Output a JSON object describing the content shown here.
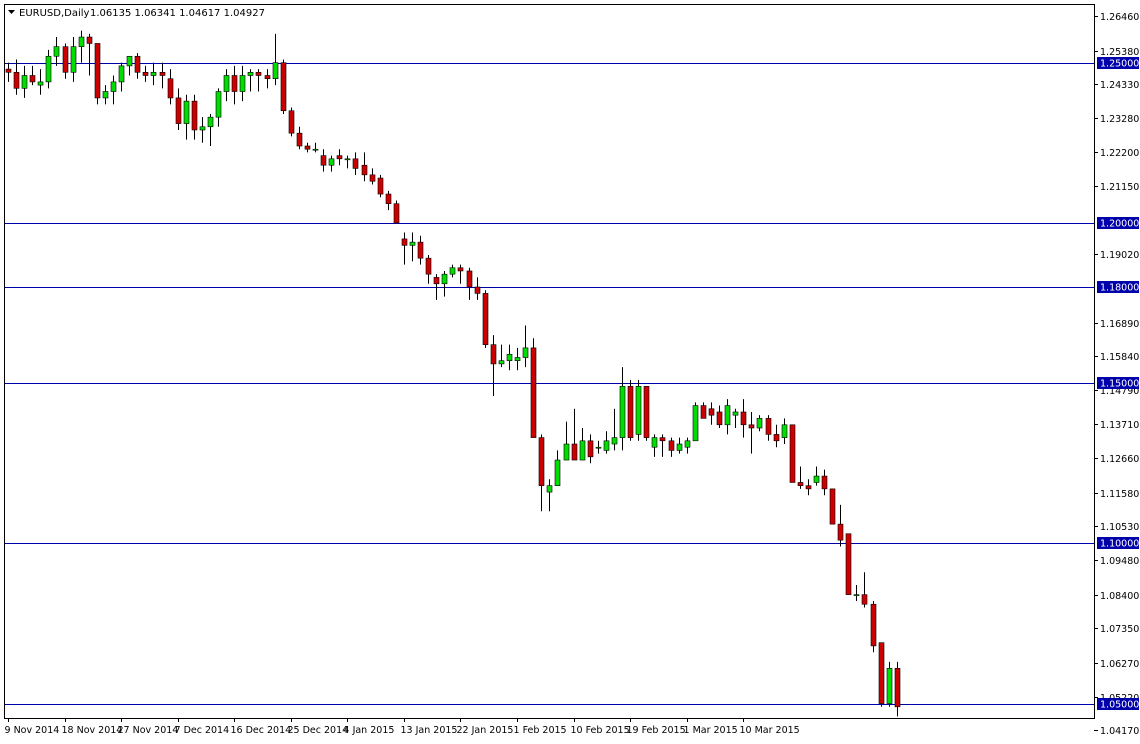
{
  "header": {
    "arrow_icon": "triangle-down-icon",
    "symbol": "EURUSD,Daily",
    "ohlc": "1.06135 1.06341 1.04617 1.04927"
  },
  "colors": {
    "background": "#ffffff",
    "frame": "#000000",
    "up_candle": "#00dd00",
    "down_candle": "#cc0000",
    "wick": "#000000",
    "level_line": "#0000aa",
    "label_bg": "#0000aa",
    "label_text": "#ffffff"
  },
  "chart_data": {
    "type": "candlestick",
    "title": "EURUSD,Daily",
    "ylim": [
      1.0455,
      1.268
    ],
    "y_ticks": [
      1.2646,
      1.2538,
      1.2433,
      1.2328,
      1.222,
      1.2115,
      1.1902,
      1.1689,
      1.1584,
      1.1479,
      1.1371,
      1.1266,
      1.1158,
      1.1053,
      1.0948,
      1.084,
      1.0735,
      1.0627,
      1.0522,
      1.0417
    ],
    "x_labels": [
      {
        "index": 0,
        "label": "9 Nov 2014"
      },
      {
        "index": 7,
        "label": "18 Nov 2014"
      },
      {
        "index": 14,
        "label": "27 Nov 2014"
      },
      {
        "index": 21,
        "label": "7 Dec 2014"
      },
      {
        "index": 28,
        "label": "16 Dec 2014"
      },
      {
        "index": 35,
        "label": "25 Dec 2014"
      },
      {
        "index": 42,
        "label": "4 Jan 2015"
      },
      {
        "index": 49,
        "label": "13 Jan 2015"
      },
      {
        "index": 56,
        "label": "22 Jan 2015"
      },
      {
        "index": 63,
        "label": "1 Feb 2015"
      },
      {
        "index": 70,
        "label": "10 Feb 2015"
      },
      {
        "index": 77,
        "label": "19 Feb 2015"
      },
      {
        "index": 84,
        "label": "1 Mar 2015"
      },
      {
        "index": 91,
        "label": "10 Mar 2015"
      }
    ],
    "levels": [
      {
        "value": 1.25,
        "label": "1.25000"
      },
      {
        "value": 1.2,
        "label": "1.20000"
      },
      {
        "value": 1.18,
        "label": "1.18000"
      },
      {
        "value": 1.15,
        "label": "1.15000"
      },
      {
        "value": 1.1,
        "label": "1.10000"
      },
      {
        "value": 1.05,
        "label": "1.05000"
      }
    ],
    "candles": [
      [
        1.248,
        1.25,
        1.244,
        1.247
      ],
      [
        1.247,
        1.251,
        1.24,
        1.242
      ],
      [
        1.242,
        1.249,
        1.239,
        1.246
      ],
      [
        1.246,
        1.249,
        1.243,
        1.244
      ],
      [
        1.243,
        1.248,
        1.24,
        1.244
      ],
      [
        1.244,
        1.254,
        1.242,
        1.252
      ],
      [
        1.252,
        1.258,
        1.249,
        1.255
      ],
      [
        1.255,
        1.256,
        1.245,
        1.247
      ],
      [
        1.247,
        1.258,
        1.244,
        1.255
      ],
      [
        1.255,
        1.26,
        1.25,
        1.258
      ],
      [
        1.258,
        1.259,
        1.246,
        1.256
      ],
      [
        1.256,
        1.256,
        1.237,
        1.239
      ],
      [
        1.239,
        1.243,
        1.237,
        1.241
      ],
      [
        1.241,
        1.246,
        1.237,
        1.244
      ],
      [
        1.244,
        1.25,
        1.241,
        1.249
      ],
      [
        1.249,
        1.252,
        1.246,
        1.252
      ],
      [
        1.252,
        1.253,
        1.245,
        1.247
      ],
      [
        1.247,
        1.249,
        1.244,
        1.246
      ],
      [
        1.246,
        1.25,
        1.243,
        1.247
      ],
      [
        1.247,
        1.25,
        1.242,
        1.246
      ],
      [
        1.245,
        1.248,
        1.237,
        1.239
      ],
      [
        1.239,
        1.242,
        1.229,
        1.231
      ],
      [
        1.231,
        1.24,
        1.226,
        1.238
      ],
      [
        1.238,
        1.24,
        1.226,
        1.229
      ],
      [
        1.229,
        1.233,
        1.225,
        1.23
      ],
      [
        1.23,
        1.234,
        1.224,
        1.233
      ],
      [
        1.233,
        1.242,
        1.23,
        1.241
      ],
      [
        1.241,
        1.248,
        1.238,
        1.246
      ],
      [
        1.246,
        1.249,
        1.237,
        1.241
      ],
      [
        1.241,
        1.249,
        1.238,
        1.246
      ],
      [
        1.246,
        1.248,
        1.241,
        1.247
      ],
      [
        1.247,
        1.248,
        1.241,
        1.246
      ],
      [
        1.246,
        1.248,
        1.242,
        1.245
      ],
      [
        1.245,
        1.259,
        1.243,
        1.25
      ],
      [
        1.25,
        1.251,
        1.234,
        1.235
      ],
      [
        1.235,
        1.236,
        1.227,
        1.228
      ],
      [
        1.228,
        1.23,
        1.223,
        1.224
      ],
      [
        1.224,
        1.225,
        1.222,
        1.223
      ],
      [
        1.223,
        1.225,
        1.222,
        1.223
      ],
      [
        1.221,
        1.223,
        1.216,
        1.218
      ],
      [
        1.218,
        1.221,
        1.216,
        1.22
      ],
      [
        1.221,
        1.223,
        1.218,
        1.22
      ],
      [
        1.22,
        1.221,
        1.217,
        1.22
      ],
      [
        1.22,
        1.222,
        1.215,
        1.217
      ],
      [
        1.218,
        1.222,
        1.213,
        1.215
      ],
      [
        1.215,
        1.217,
        1.212,
        1.213
      ],
      [
        1.214,
        1.215,
        1.208,
        1.209
      ],
      [
        1.209,
        1.21,
        1.204,
        1.206
      ],
      [
        1.206,
        1.207,
        1.2,
        1.2
      ],
      [
        1.195,
        1.197,
        1.187,
        1.193
      ],
      [
        1.193,
        1.197,
        1.188,
        1.194
      ],
      [
        1.194,
        1.196,
        1.187,
        1.189
      ],
      [
        1.189,
        1.19,
        1.181,
        1.184
      ],
      [
        1.183,
        1.184,
        1.176,
        1.181
      ],
      [
        1.181,
        1.185,
        1.177,
        1.184
      ],
      [
        1.184,
        1.187,
        1.183,
        1.186
      ],
      [
        1.186,
        1.187,
        1.181,
        1.185
      ],
      [
        1.185,
        1.186,
        1.176,
        1.18
      ],
      [
        1.18,
        1.183,
        1.176,
        1.178
      ],
      [
        1.178,
        1.179,
        1.161,
        1.162
      ],
      [
        1.162,
        1.165,
        1.146,
        1.156
      ],
      [
        1.156,
        1.162,
        1.155,
        1.157
      ],
      [
        1.157,
        1.162,
        1.154,
        1.159
      ],
      [
        1.157,
        1.161,
        1.154,
        1.158
      ],
      [
        1.158,
        1.168,
        1.155,
        1.161
      ],
      [
        1.161,
        1.164,
        1.133,
        1.133
      ],
      [
        1.133,
        1.134,
        1.11,
        1.118
      ],
      [
        1.116,
        1.12,
        1.11,
        1.118
      ],
      [
        1.118,
        1.129,
        1.118,
        1.126
      ],
      [
        1.126,
        1.138,
        1.126,
        1.131
      ],
      [
        1.131,
        1.142,
        1.126,
        1.126
      ],
      [
        1.126,
        1.136,
        1.126,
        1.132
      ],
      [
        1.132,
        1.134,
        1.125,
        1.127
      ],
      [
        1.13,
        1.132,
        1.128,
        1.13
      ],
      [
        1.129,
        1.135,
        1.128,
        1.132
      ],
      [
        1.131,
        1.142,
        1.129,
        1.133
      ],
      [
        1.133,
        1.155,
        1.129,
        1.149
      ],
      [
        1.149,
        1.151,
        1.132,
        1.133
      ],
      [
        1.134,
        1.151,
        1.132,
        1.149
      ],
      [
        1.149,
        1.149,
        1.132,
        1.133
      ],
      [
        1.13,
        1.134,
        1.127,
        1.133
      ],
      [
        1.133,
        1.134,
        1.127,
        1.132
      ],
      [
        1.132,
        1.133,
        1.127,
        1.129
      ],
      [
        1.129,
        1.133,
        1.128,
        1.131
      ],
      [
        1.13,
        1.133,
        1.128,
        1.132
      ],
      [
        1.132,
        1.144,
        1.132,
        1.143
      ],
      [
        1.143,
        1.144,
        1.139,
        1.139
      ],
      [
        1.142,
        1.144,
        1.137,
        1.14
      ],
      [
        1.141,
        1.143,
        1.136,
        1.137
      ],
      [
        1.137,
        1.145,
        1.134,
        1.143
      ],
      [
        1.14,
        1.142,
        1.136,
        1.141
      ],
      [
        1.141,
        1.145,
        1.133,
        1.137
      ],
      [
        1.137,
        1.141,
        1.128,
        1.136
      ],
      [
        1.136,
        1.14,
        1.135,
        1.139
      ],
      [
        1.139,
        1.14,
        1.132,
        1.134
      ],
      [
        1.134,
        1.137,
        1.13,
        1.132
      ],
      [
        1.133,
        1.139,
        1.131,
        1.137
      ],
      [
        1.137,
        1.137,
        1.119,
        1.119
      ],
      [
        1.119,
        1.124,
        1.117,
        1.118
      ],
      [
        1.118,
        1.12,
        1.115,
        1.117
      ],
      [
        1.119,
        1.124,
        1.118,
        1.121
      ],
      [
        1.121,
        1.123,
        1.115,
        1.117
      ],
      [
        1.117,
        1.117,
        1.106,
        1.106
      ],
      [
        1.106,
        1.112,
        1.099,
        1.101
      ],
      [
        1.103,
        1.103,
        1.084,
        1.084
      ],
      [
        1.084,
        1.087,
        1.082,
        1.084
      ],
      [
        1.084,
        1.091,
        1.08,
        1.081
      ],
      [
        1.081,
        1.082,
        1.066,
        1.068
      ],
      [
        1.069,
        1.069,
        1.049,
        1.05
      ],
      [
        1.05,
        1.063,
        1.049,
        1.061
      ],
      [
        1.061,
        1.063,
        1.046,
        1.049
      ]
    ]
  }
}
